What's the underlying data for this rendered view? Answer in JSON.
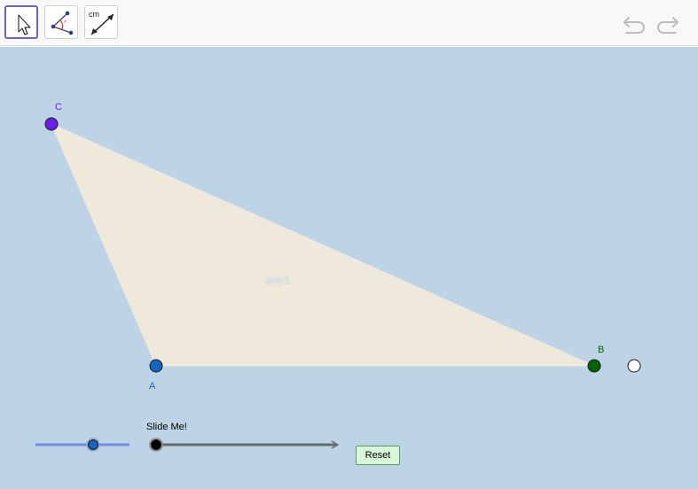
{
  "toolbar": {
    "tools": [
      {
        "icon": "arrow-pointer-icon",
        "selected": true
      },
      {
        "icon": "angle-icon",
        "selected": false
      },
      {
        "icon": "distance-icon",
        "selected": false,
        "label": "cm"
      }
    ],
    "undo_icon": "undo-icon",
    "redo_icon": "redo-icon"
  },
  "canvas": {
    "background": "#bdd3e6",
    "polygon_label": "poly1",
    "points": {
      "A": {
        "label": "A",
        "color": "#1565c0"
      },
      "B": {
        "label": "B",
        "color": "#006400"
      },
      "C": {
        "label": "C",
        "color": "#6a1ee8"
      }
    },
    "polygon_fill": "#efe9dc"
  },
  "controls": {
    "slider_label": "Slide Me!",
    "reset_label": "Reset",
    "slider_1_value": 0.6,
    "slider_2_value": 0.0
  }
}
